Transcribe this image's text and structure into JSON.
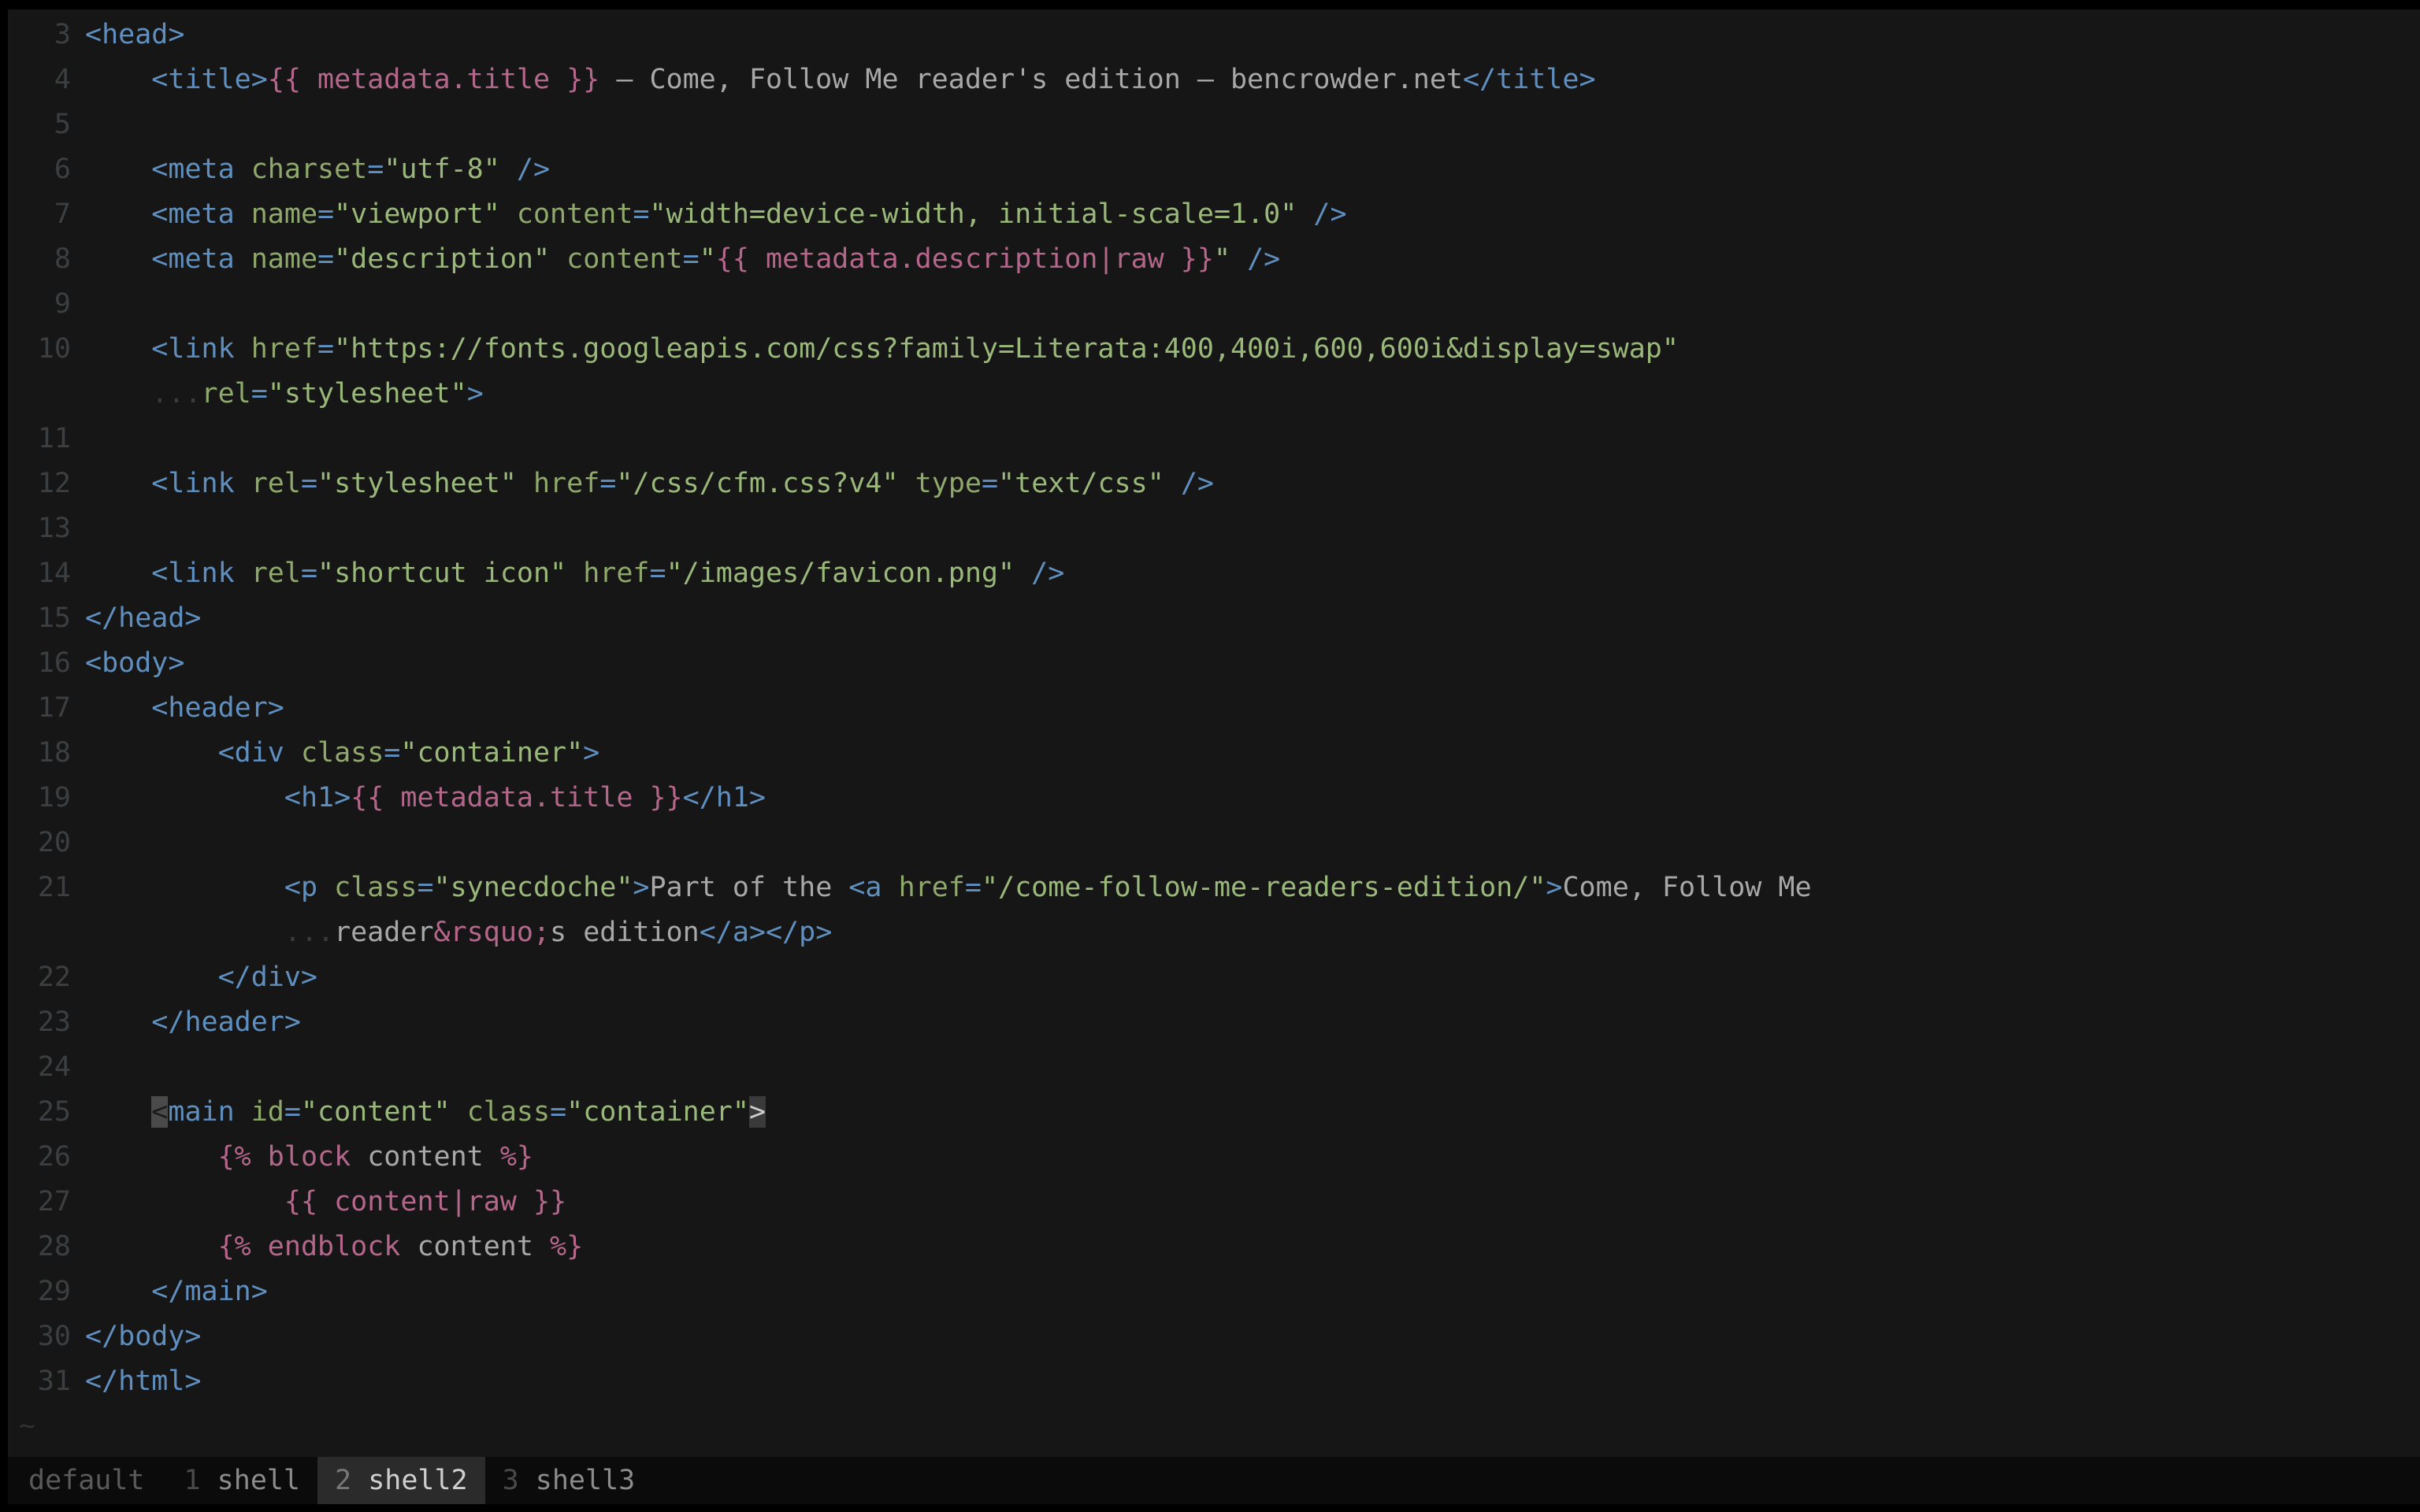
{
  "app": {
    "kind": "terminal-text-editor",
    "theme_background": "#161616",
    "colors": {
      "tag": "#5f8fbf",
      "attribute": "#8fa86b",
      "string": "#9ab87a",
      "jinja": "#b5678b",
      "plain_text": "#a8a8a8",
      "line_number": "#3c3f41",
      "cursor": "#4a4a4a",
      "status_bar_bg": "#0b0b0b",
      "active_window_bg": "#2b2b2b"
    }
  },
  "editor": {
    "lines": [
      {
        "number": "3",
        "tokens": [
          {
            "t": "tag",
            "v": "<head>"
          }
        ]
      },
      {
        "number": "4",
        "tokens": [
          {
            "t": "plain",
            "v": "    "
          },
          {
            "t": "tag",
            "v": "<title>"
          },
          {
            "t": "jinja",
            "v": "{{ metadata.title }}"
          },
          {
            "t": "plain",
            "v": " — Come, Follow Me reader's edition — bencrowder.net"
          },
          {
            "t": "tag",
            "v": "</title>"
          }
        ]
      },
      {
        "number": "5",
        "tokens": []
      },
      {
        "number": "6",
        "tokens": [
          {
            "t": "plain",
            "v": "    "
          },
          {
            "t": "tag",
            "v": "<meta "
          },
          {
            "t": "attr",
            "v": "charset"
          },
          {
            "t": "eq",
            "v": "="
          },
          {
            "t": "str",
            "v": "\"utf-8\""
          },
          {
            "t": "plain",
            "v": " "
          },
          {
            "t": "tag",
            "v": "/>"
          }
        ]
      },
      {
        "number": "7",
        "tokens": [
          {
            "t": "plain",
            "v": "    "
          },
          {
            "t": "tag",
            "v": "<meta "
          },
          {
            "t": "attr",
            "v": "name"
          },
          {
            "t": "eq",
            "v": "="
          },
          {
            "t": "str",
            "v": "\"viewport\""
          },
          {
            "t": "plain",
            "v": " "
          },
          {
            "t": "attr",
            "v": "content"
          },
          {
            "t": "eq",
            "v": "="
          },
          {
            "t": "str",
            "v": "\"width=device-width, initial-scale=1.0\""
          },
          {
            "t": "plain",
            "v": " "
          },
          {
            "t": "tag",
            "v": "/>"
          }
        ]
      },
      {
        "number": "8",
        "tokens": [
          {
            "t": "plain",
            "v": "    "
          },
          {
            "t": "tag",
            "v": "<meta "
          },
          {
            "t": "attr",
            "v": "name"
          },
          {
            "t": "eq",
            "v": "="
          },
          {
            "t": "str",
            "v": "\"description\""
          },
          {
            "t": "plain",
            "v": " "
          },
          {
            "t": "attr",
            "v": "content"
          },
          {
            "t": "eq",
            "v": "="
          },
          {
            "t": "str",
            "v": "\""
          },
          {
            "t": "jinja",
            "v": "{{ metadata.description|raw }}"
          },
          {
            "t": "str",
            "v": "\""
          },
          {
            "t": "plain",
            "v": " "
          },
          {
            "t": "tag",
            "v": "/>"
          }
        ]
      },
      {
        "number": "9",
        "tokens": []
      },
      {
        "number": "10",
        "tokens": [
          {
            "t": "plain",
            "v": "    "
          },
          {
            "t": "tag",
            "v": "<link "
          },
          {
            "t": "attr",
            "v": "href"
          },
          {
            "t": "eq",
            "v": "="
          },
          {
            "t": "str",
            "v": "\"https://fonts.googleapis.com/css?family=Literata:400,400i,600,600i&display=swap\""
          }
        ]
      },
      {
        "number": "",
        "wrapped": true,
        "tokens": [
          {
            "t": "plain",
            "v": "    "
          },
          {
            "t": "cont",
            "v": "..."
          },
          {
            "t": "attr",
            "v": "rel"
          },
          {
            "t": "eq",
            "v": "="
          },
          {
            "t": "str",
            "v": "\"stylesheet\""
          },
          {
            "t": "tag",
            "v": ">"
          }
        ]
      },
      {
        "number": "11",
        "tokens": []
      },
      {
        "number": "12",
        "tokens": [
          {
            "t": "plain",
            "v": "    "
          },
          {
            "t": "tag",
            "v": "<link "
          },
          {
            "t": "attr",
            "v": "rel"
          },
          {
            "t": "eq",
            "v": "="
          },
          {
            "t": "str",
            "v": "\"stylesheet\""
          },
          {
            "t": "plain",
            "v": " "
          },
          {
            "t": "attr",
            "v": "href"
          },
          {
            "t": "eq",
            "v": "="
          },
          {
            "t": "str",
            "v": "\"/css/cfm.css?v4\""
          },
          {
            "t": "plain",
            "v": " "
          },
          {
            "t": "attr",
            "v": "type"
          },
          {
            "t": "eq",
            "v": "="
          },
          {
            "t": "str",
            "v": "\"text/css\""
          },
          {
            "t": "plain",
            "v": " "
          },
          {
            "t": "tag",
            "v": "/>"
          }
        ]
      },
      {
        "number": "13",
        "tokens": []
      },
      {
        "number": "14",
        "tokens": [
          {
            "t": "plain",
            "v": "    "
          },
          {
            "t": "tag",
            "v": "<link "
          },
          {
            "t": "attr",
            "v": "rel"
          },
          {
            "t": "eq",
            "v": "="
          },
          {
            "t": "str",
            "v": "\"shortcut icon\""
          },
          {
            "t": "plain",
            "v": " "
          },
          {
            "t": "attr",
            "v": "href"
          },
          {
            "t": "eq",
            "v": "="
          },
          {
            "t": "str",
            "v": "\"/images/favicon.png\""
          },
          {
            "t": "plain",
            "v": " "
          },
          {
            "t": "tag",
            "v": "/>"
          }
        ]
      },
      {
        "number": "15",
        "tokens": [
          {
            "t": "tag",
            "v": "</head>"
          }
        ]
      },
      {
        "number": "16",
        "tokens": [
          {
            "t": "tag",
            "v": "<body>"
          }
        ]
      },
      {
        "number": "17",
        "tokens": [
          {
            "t": "plain",
            "v": "    "
          },
          {
            "t": "tag",
            "v": "<header>"
          }
        ]
      },
      {
        "number": "18",
        "tokens": [
          {
            "t": "plain",
            "v": "        "
          },
          {
            "t": "tag",
            "v": "<div "
          },
          {
            "t": "attr",
            "v": "class"
          },
          {
            "t": "eq",
            "v": "="
          },
          {
            "t": "str",
            "v": "\"container\""
          },
          {
            "t": "tag",
            "v": ">"
          }
        ]
      },
      {
        "number": "19",
        "tokens": [
          {
            "t": "plain",
            "v": "            "
          },
          {
            "t": "tag",
            "v": "<h1>"
          },
          {
            "t": "jinja",
            "v": "{{ metadata.title }}"
          },
          {
            "t": "tag",
            "v": "</h1>"
          }
        ]
      },
      {
        "number": "20",
        "tokens": []
      },
      {
        "number": "21",
        "tokens": [
          {
            "t": "plain",
            "v": "            "
          },
          {
            "t": "tag",
            "v": "<p "
          },
          {
            "t": "attr",
            "v": "class"
          },
          {
            "t": "eq",
            "v": "="
          },
          {
            "t": "str",
            "v": "\"synecdoche\""
          },
          {
            "t": "tag",
            "v": ">"
          },
          {
            "t": "plain",
            "v": "Part of the "
          },
          {
            "t": "tag",
            "v": "<a "
          },
          {
            "t": "attr",
            "v": "href"
          },
          {
            "t": "eq",
            "v": "="
          },
          {
            "t": "str",
            "v": "\"/come-follow-me-readers-edition/\""
          },
          {
            "t": "tag",
            "v": ">"
          },
          {
            "t": "plain",
            "v": "Come, Follow Me"
          }
        ]
      },
      {
        "number": "",
        "wrapped": true,
        "tokens": [
          {
            "t": "plain",
            "v": "            "
          },
          {
            "t": "cont",
            "v": "..."
          },
          {
            "t": "plain",
            "v": "reader"
          },
          {
            "t": "jinja",
            "v": "&rsquo;"
          },
          {
            "t": "plain",
            "v": "s edition"
          },
          {
            "t": "tag",
            "v": "</a></p>"
          }
        ]
      },
      {
        "number": "22",
        "tokens": [
          {
            "t": "plain",
            "v": "        "
          },
          {
            "t": "tag",
            "v": "</div>"
          }
        ]
      },
      {
        "number": "23",
        "tokens": [
          {
            "t": "plain",
            "v": "    "
          },
          {
            "t": "tag",
            "v": "</header>"
          }
        ]
      },
      {
        "number": "24",
        "tokens": []
      },
      {
        "number": "25",
        "tokens": [
          {
            "t": "plain",
            "v": "    "
          },
          {
            "t": "cursor",
            "v": "<"
          },
          {
            "t": "tag",
            "v": "main "
          },
          {
            "t": "attr",
            "v": "id"
          },
          {
            "t": "eq",
            "v": "="
          },
          {
            "t": "str",
            "v": "\"content\""
          },
          {
            "t": "plain",
            "v": " "
          },
          {
            "t": "attr",
            "v": "class"
          },
          {
            "t": "eq",
            "v": "="
          },
          {
            "t": "str",
            "v": "\"container\""
          },
          {
            "t": "matchparen",
            "v": ">"
          }
        ]
      },
      {
        "number": "26",
        "tokens": [
          {
            "t": "plain",
            "v": "        "
          },
          {
            "t": "jinja",
            "v": "{% "
          },
          {
            "t": "jinja",
            "v": "block "
          },
          {
            "t": "plain",
            "v": "content "
          },
          {
            "t": "jinja",
            "v": "%}"
          }
        ]
      },
      {
        "number": "27",
        "tokens": [
          {
            "t": "plain",
            "v": "            "
          },
          {
            "t": "jinja",
            "v": "{{ content|raw }}"
          }
        ]
      },
      {
        "number": "28",
        "tokens": [
          {
            "t": "plain",
            "v": "        "
          },
          {
            "t": "jinja",
            "v": "{% "
          },
          {
            "t": "jinja",
            "v": "endblock "
          },
          {
            "t": "plain",
            "v": "content "
          },
          {
            "t": "jinja",
            "v": "%}"
          }
        ]
      },
      {
        "number": "29",
        "tokens": [
          {
            "t": "plain",
            "v": "    "
          },
          {
            "t": "tag",
            "v": "</main>"
          }
        ]
      },
      {
        "number": "30",
        "tokens": [
          {
            "t": "tag",
            "v": "</body>"
          }
        ]
      },
      {
        "number": "31",
        "tokens": [
          {
            "t": "tag",
            "v": "</html>"
          }
        ]
      },
      {
        "number": "~",
        "filler": true,
        "tokens": []
      }
    ]
  },
  "statusbar": {
    "session_label": "default",
    "windows": [
      {
        "index": "1",
        "name": "shell",
        "active": false
      },
      {
        "index": "2",
        "name": "shell2",
        "active": true
      },
      {
        "index": "3",
        "name": "shell3",
        "active": false
      }
    ]
  }
}
